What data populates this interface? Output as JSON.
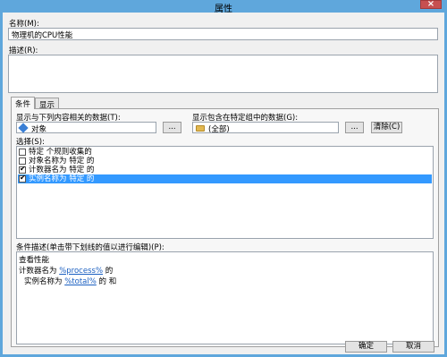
{
  "window": {
    "title": "属性",
    "close_glyph": "×"
  },
  "name": {
    "label": "名称(M):",
    "value": "物理机的CPU性能"
  },
  "description": {
    "label": "描述(R):",
    "value": ""
  },
  "tabs": [
    {
      "label": "条件"
    },
    {
      "label": "显示"
    }
  ],
  "condition": {
    "related_data_label": "显示与下列内容相关的数据(T):",
    "related_data_value": "对象",
    "ellipsis_label": "...",
    "group_label": "显示包含在特定组中的数据(G):",
    "group_value": "(全部)",
    "group_ellipsis_label": "...",
    "clear_button": "清除(C)",
    "select_label": "选择(S):",
    "criteria": [
      {
        "checked": false,
        "text": "特定 个规则收集的"
      },
      {
        "checked": false,
        "text": "对象名称为 特定 的"
      },
      {
        "checked": true,
        "text": "计数器名为 特定 的"
      },
      {
        "checked": true,
        "text": "实例名称为 特定 的",
        "selected": true
      }
    ],
    "check_glyph": "✔",
    "desc_label": "条件描述(单击带下划线的值以进行编辑)(P):",
    "desc_lines": {
      "line1": "查看性能",
      "line2_prefix": "计数器名为 ",
      "line2_link": "%process%",
      "line2_suffix": " 的",
      "line3_prefix": "实例名称为 ",
      "line3_link": "%total%",
      "line3_suffix": " 的 和"
    }
  },
  "footer": {
    "ok": "确定",
    "cancel": "取消"
  }
}
